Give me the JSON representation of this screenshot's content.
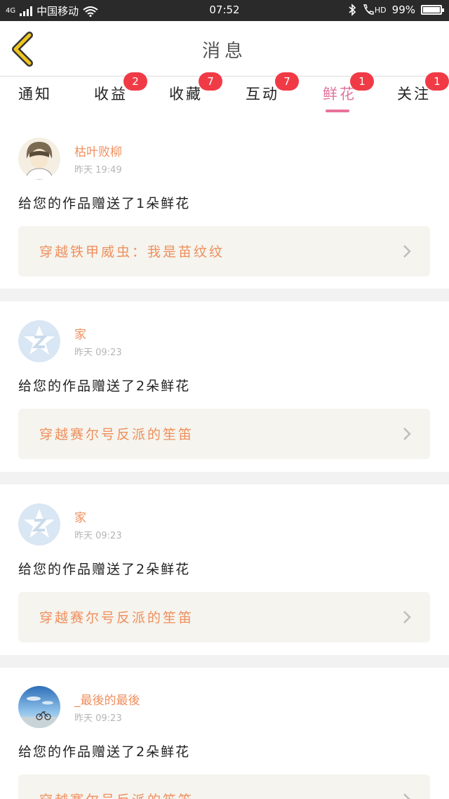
{
  "status_bar": {
    "network": "4G",
    "carrier": "中国移动",
    "time": "07:52",
    "hd_label": "HD",
    "battery": "99%",
    "battery_level": 0.99
  },
  "header": {
    "back_icon": "chevron-left-icon",
    "title": "消息"
  },
  "tabs": [
    {
      "label": "通知",
      "badge": ""
    },
    {
      "label": "收益",
      "badge": "2"
    },
    {
      "label": "收藏",
      "badge": "7"
    },
    {
      "label": "互动",
      "badge": "7"
    },
    {
      "label": "鲜花",
      "badge": "1",
      "active": true
    },
    {
      "label": "关注",
      "badge": "1"
    }
  ],
  "messages": [
    {
      "user": "枯叶败柳",
      "time": "昨天 19:49",
      "text": "给您的作品赠送了1朵鲜花",
      "work": "穿越铁甲威虫：我是苗纹纹",
      "avatar": "anime-avatar"
    },
    {
      "user": "家",
      "time": "昨天 09:23",
      "text": "给您的作品赠送了2朵鲜花",
      "work": "穿越赛尔号反派的笙笛",
      "avatar": "default-star-avatar"
    },
    {
      "user": "家",
      "time": "昨天 09:23",
      "text": "给您的作品赠送了2朵鲜花",
      "work": "穿越赛尔号反派的笙笛",
      "avatar": "default-star-avatar"
    },
    {
      "user": "_最後的最後",
      "time": "昨天 09:23",
      "text": "给您的作品赠送了2朵鲜花",
      "work": "穿越赛尔号反派的笙笛",
      "avatar": "sky-bicycle-avatar"
    }
  ],
  "colors": {
    "accent": "#e0759d",
    "badge": "#f03b46",
    "username": "#ef8f5d",
    "back_icon": "#e8b800"
  }
}
